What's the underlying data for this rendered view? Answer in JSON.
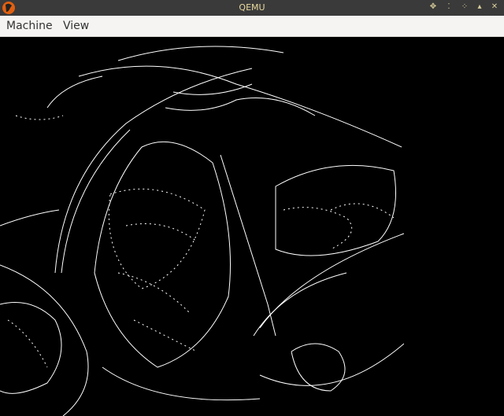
{
  "window": {
    "title": "QEMU",
    "buttons": [
      "pin-icon",
      "minimize-icon",
      "restore-icon",
      "maximize-icon",
      "close-icon"
    ]
  },
  "menubar": {
    "items": [
      {
        "label": "Machine"
      },
      {
        "label": "View"
      }
    ]
  },
  "colors": {
    "titlebar": "#3a3a3a",
    "menubar": "#f5f4f2",
    "title_text": "#e8d9a0"
  }
}
